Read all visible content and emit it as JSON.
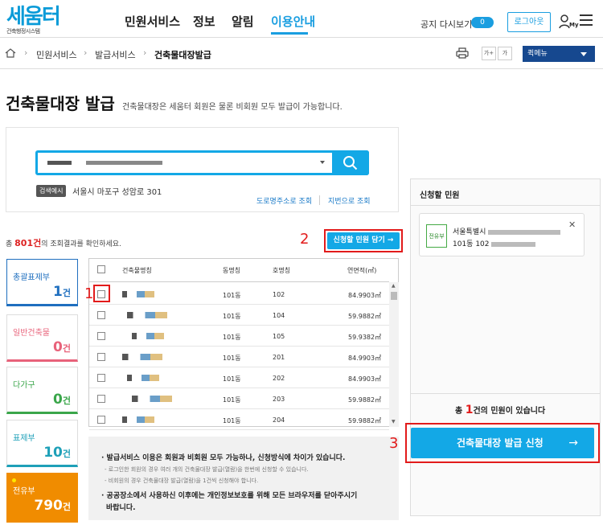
{
  "header": {
    "logo_text": "세움터",
    "logo_sub": "건축행정시스템",
    "nav": [
      "민원서비스",
      "정보",
      "알림",
      "이용안내"
    ],
    "notice_toggle_label": "공지 다시보기",
    "notice_toggle_value": "0",
    "logout_label": "로그아웃",
    "my_label": "My"
  },
  "breadcrumb": {
    "items": [
      "민원서비스",
      "발급서비스",
      "건축물대장발급"
    ],
    "font_plus": "가+",
    "font_minus": "가",
    "quick_menu": "퀵메뉴"
  },
  "page": {
    "title": "건축물대장 발급",
    "subtitle": "건축물대장은 세움터 회원은 물론 비회원 모두 발급이 가능합니다."
  },
  "search": {
    "example_tag": "검색예시",
    "example_text": "서울시 마포구 성암로 301",
    "link_road": "도로명주소로 조회",
    "link_lot": "지번으로 조회"
  },
  "results": {
    "count_prefix": "총",
    "count": "801건",
    "count_suffix": "의 조회결과를 확인하세요.",
    "add_button": "신청할 민원 담기 →"
  },
  "categories": [
    {
      "label": "총괄표제부",
      "count": "1",
      "unit": "건",
      "color": "#1f6fbf"
    },
    {
      "label": "일반건축물",
      "count": "0",
      "unit": "건",
      "color": "#e8627a"
    },
    {
      "label": "다가구",
      "count": "0",
      "unit": "건",
      "color": "#3aa64a"
    },
    {
      "label": "표제부",
      "count": "10",
      "unit": "건",
      "color": "#1ea0b8"
    },
    {
      "label": "전유부",
      "count": "790",
      "unit": "건",
      "color": "#f08c00"
    }
  ],
  "table": {
    "headers": [
      "건축물명칭",
      "동명칭",
      "호명칭",
      "연면적(㎡)"
    ],
    "rows": [
      {
        "dong": "101동",
        "ho": "102",
        "area": "84.9903㎡"
      },
      {
        "dong": "101동",
        "ho": "104",
        "area": "59.9882㎡"
      },
      {
        "dong": "101동",
        "ho": "105",
        "area": "59.9382㎡"
      },
      {
        "dong": "101동",
        "ho": "201",
        "area": "84.9903㎡"
      },
      {
        "dong": "101동",
        "ho": "202",
        "area": "84.9903㎡"
      },
      {
        "dong": "101동",
        "ho": "203",
        "area": "59.9882㎡"
      },
      {
        "dong": "101동",
        "ho": "204",
        "area": "59.9882㎡"
      }
    ]
  },
  "notice": {
    "l1": "· 발급서비스 이용은 회원과 비회원 모두 가능하나, 신청방식에 차이가 있습니다.",
    "l2": "- 로그인한 회원의 경우 여러 개의 건축물대장 발급(열람)을 한번에 신청할 수 있습니다.",
    "l3": "- 비회원의 경우 건축물대장 발급(열람)을 1건씩 신청해야 합니다.",
    "l4": "· 공공장소에서 사용하신 이후에는 개인정보보호를 위해 모든 브라우저를 닫아주시기",
    "l5": "바랍니다."
  },
  "apply_panel": {
    "title": "신청할 민원",
    "item_tag": "전유부",
    "item_line1": "서울특별시",
    "item_line2": "101동 102",
    "total_prefix": "총",
    "total_count": "1",
    "total_suffix": "건의 민원이 있습니다",
    "issue_button": "건축물대장 발급 신청",
    "issue_arrow": "→"
  },
  "annotations": [
    "1",
    "2",
    "3"
  ]
}
